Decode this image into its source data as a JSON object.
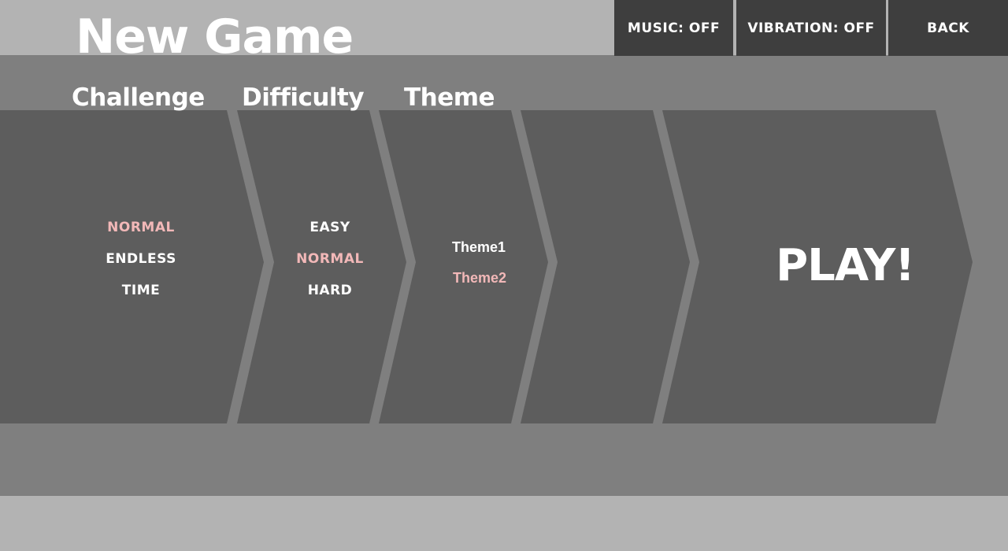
{
  "screen": {
    "title": "New Game"
  },
  "topbar": {
    "music_label": "MUSIC: OFF",
    "vibration_label": "VIBRATION: OFF",
    "back_label": "BACK"
  },
  "columns": {
    "challenge": {
      "header": "Challenge",
      "options": [
        "NORMAL",
        "ENDLESS",
        "TIME"
      ],
      "selected": "NORMAL"
    },
    "difficulty": {
      "header": "Difficulty",
      "options": [
        "EASY",
        "NORMAL",
        "HARD"
      ],
      "selected": "NORMAL"
    },
    "theme": {
      "header": "Theme",
      "options": [
        "Theme1",
        "Theme2"
      ],
      "selected": "Theme2"
    }
  },
  "play_label": "PLAY!",
  "colors": {
    "background": "#b3b3b3",
    "band": "#7f7f7f",
    "panel": "#5d5d5d",
    "button": "#3e3e3e",
    "text": "#ffffff",
    "selected": "#f2b8b8"
  }
}
